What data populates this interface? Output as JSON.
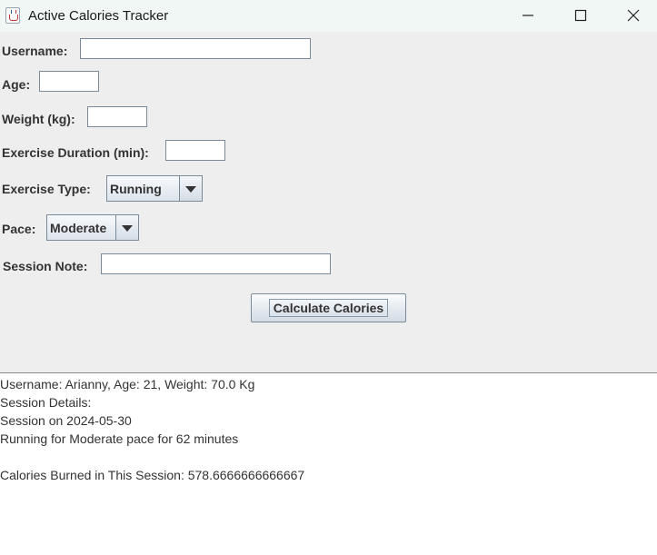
{
  "window": {
    "title": "Active Calories Tracker"
  },
  "form": {
    "username_label": "Username:",
    "username_value": "",
    "age_label": "Age:",
    "age_value": "",
    "weight_label": "Weight (kg):",
    "weight_value": "",
    "duration_label": "Exercise Duration (min):",
    "duration_value": "",
    "exercise_type_label": "Exercise Type:",
    "exercise_type_selected": "Running",
    "pace_label": "Pace:",
    "pace_selected": "Moderate",
    "note_label": "Session Note:",
    "note_value": "",
    "calculate_label": "Calculate Calories"
  },
  "output": {
    "lines": [
      "Username: Arianny, Age: 21, Weight: 70.0 Kg",
      "Session Details:",
      "Session on 2024-05-30",
      "Running for Moderate pace for 62 minutes",
      "",
      "Calories Burned in This Session: 578.6666666666667"
    ]
  }
}
